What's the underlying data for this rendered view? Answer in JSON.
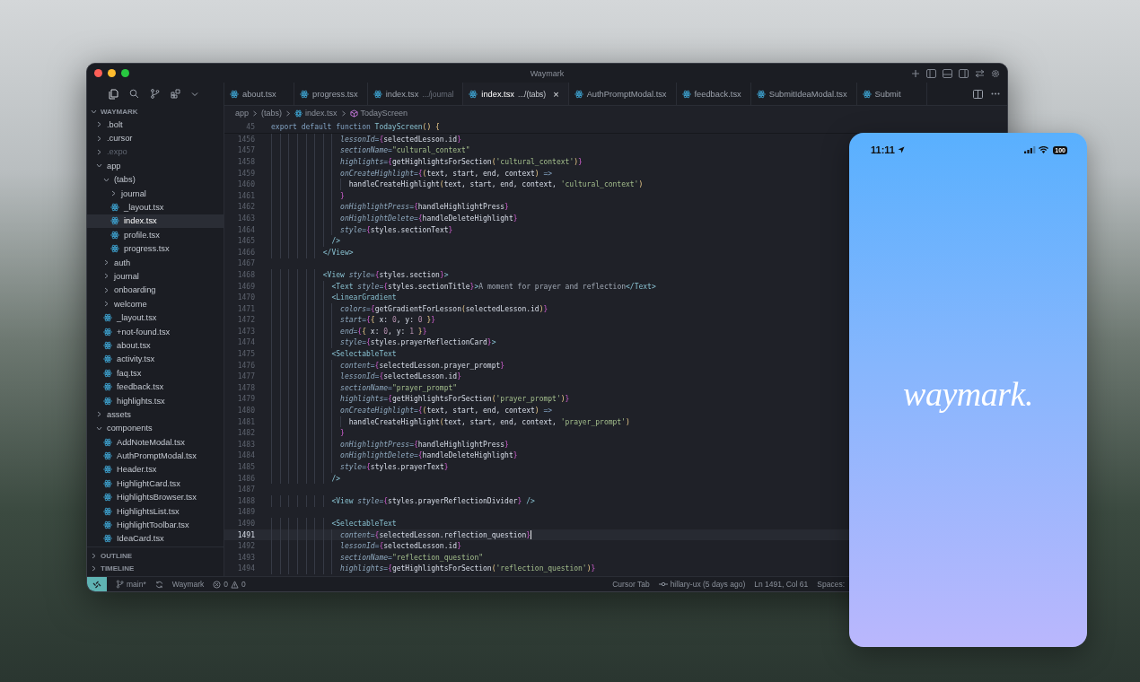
{
  "window": {
    "title": "Waymark"
  },
  "sidebar": {
    "section": {
      "title": "WAYMARK",
      "expanded": true
    },
    "tree": [
      {
        "name": ".bolt",
        "kind": "folder",
        "expanded": false,
        "selected": false,
        "ignored": false
      },
      {
        "name": ".cursor",
        "kind": "folder",
        "expanded": false,
        "selected": false,
        "ignored": false
      },
      {
        "name": ".expo",
        "kind": "folder",
        "expanded": false,
        "selected": false,
        "ignored": true
      },
      {
        "name": "app",
        "kind": "folder",
        "expanded": true,
        "selected": false,
        "ignored": false,
        "children": [
          {
            "name": "(tabs)",
            "kind": "folder",
            "expanded": true,
            "selected": false,
            "ignored": false,
            "children": [
              {
                "name": "journal",
                "kind": "folder",
                "expanded": false,
                "selected": false,
                "ignored": false
              },
              {
                "name": "_layout.tsx",
                "kind": "file",
                "selected": false,
                "ignored": false
              },
              {
                "name": "index.tsx",
                "kind": "file",
                "selected": true,
                "ignored": false
              },
              {
                "name": "profile.tsx",
                "kind": "file",
                "selected": false,
                "ignored": false
              },
              {
                "name": "progress.tsx",
                "kind": "file",
                "selected": false,
                "ignored": false
              }
            ]
          },
          {
            "name": "auth",
            "kind": "folder",
            "expanded": false,
            "selected": false,
            "ignored": false
          },
          {
            "name": "journal",
            "kind": "folder",
            "expanded": false,
            "selected": false,
            "ignored": false
          },
          {
            "name": "onboarding",
            "kind": "folder",
            "expanded": false,
            "selected": false,
            "ignored": false
          },
          {
            "name": "welcome",
            "kind": "folder",
            "expanded": false,
            "selected": false,
            "ignored": false
          },
          {
            "name": "_layout.tsx",
            "kind": "file",
            "selected": false,
            "ignored": false
          },
          {
            "name": "+not-found.tsx",
            "kind": "file",
            "selected": false,
            "ignored": false
          },
          {
            "name": "about.tsx",
            "kind": "file",
            "selected": false,
            "ignored": false
          },
          {
            "name": "activity.tsx",
            "kind": "file",
            "selected": false,
            "ignored": false
          },
          {
            "name": "faq.tsx",
            "kind": "file",
            "selected": false,
            "ignored": false
          },
          {
            "name": "feedback.tsx",
            "kind": "file",
            "selected": false,
            "ignored": false
          },
          {
            "name": "highlights.tsx",
            "kind": "file",
            "selected": false,
            "ignored": false
          }
        ]
      },
      {
        "name": "assets",
        "kind": "folder",
        "expanded": false,
        "selected": false,
        "ignored": false
      },
      {
        "name": "components",
        "kind": "folder",
        "expanded": true,
        "selected": false,
        "ignored": false,
        "children": [
          {
            "name": "AddNoteModal.tsx",
            "kind": "file",
            "selected": false,
            "ignored": false
          },
          {
            "name": "AuthPromptModal.tsx",
            "kind": "file",
            "selected": false,
            "ignored": false
          },
          {
            "name": "Header.tsx",
            "kind": "file",
            "selected": false,
            "ignored": false
          },
          {
            "name": "HighlightCard.tsx",
            "kind": "file",
            "selected": false,
            "ignored": false
          },
          {
            "name": "HighlightsBrowser.tsx",
            "kind": "file",
            "selected": false,
            "ignored": false
          },
          {
            "name": "HighlightsList.tsx",
            "kind": "file",
            "selected": false,
            "ignored": false
          },
          {
            "name": "HighlightToolbar.tsx",
            "kind": "file",
            "selected": false,
            "ignored": false
          },
          {
            "name": "IdeaCard.tsx",
            "kind": "file",
            "selected": false,
            "ignored": false
          }
        ]
      }
    ],
    "panels": [
      {
        "title": "OUTLINE",
        "expanded": false
      },
      {
        "title": "TIMELINE",
        "expanded": false
      }
    ]
  },
  "tabs": [
    {
      "label": "about.tsx",
      "selected": false
    },
    {
      "label": "progress.tsx",
      "selected": false
    },
    {
      "label": "index.tsx",
      "description": ".../journal",
      "selected": false
    },
    {
      "label": "index.tsx",
      "description": ".../(tabs)",
      "selected": true,
      "close": "×"
    },
    {
      "label": "AuthPromptModal.tsx",
      "selected": false
    },
    {
      "label": "feedback.tsx",
      "selected": false
    },
    {
      "label": "SubmitIdeaModal.tsx",
      "selected": false
    },
    {
      "label": "Submit",
      "selected": false
    }
  ],
  "breadcrumb": [
    {
      "label": "app",
      "kind": "folder"
    },
    {
      "label": "(tabs)",
      "kind": "folder"
    },
    {
      "label": "index.tsx",
      "kind": "file"
    },
    {
      "label": "TodayScreen",
      "kind": "symbol"
    }
  ],
  "editor": {
    "sticky": {
      "number": "45",
      "tokens": [
        {
          "kind": "kw",
          "text": "export default function "
        },
        {
          "kind": "fn",
          "text": "TodayScreen"
        },
        {
          "kind": "paren",
          "text": "() {"
        }
      ]
    },
    "lines": [
      {
        "number": "1456",
        "active": false,
        "tokens": [
          {
            "kind": "attr",
            "text": "                lessonId"
          },
          {
            "kind": "punc",
            "text": "="
          },
          {
            "kind": "brace",
            "text": "{"
          },
          {
            "kind": "text",
            "text": "selectedLesson.id"
          },
          {
            "kind": "brace",
            "text": "}"
          }
        ]
      },
      {
        "number": "1457",
        "active": false,
        "tokens": [
          {
            "kind": "attr",
            "text": "                sectionName"
          },
          {
            "kind": "punc",
            "text": "="
          },
          {
            "kind": "str",
            "text": "\"cultural_context\""
          }
        ]
      },
      {
        "number": "1458",
        "active": false,
        "tokens": [
          {
            "kind": "attr",
            "text": "                highlights"
          },
          {
            "kind": "punc",
            "text": "="
          },
          {
            "kind": "brace",
            "text": "{"
          },
          {
            "kind": "text",
            "text": "getHighlightsForSection"
          },
          {
            "kind": "paren",
            "text": "("
          },
          {
            "kind": "str",
            "text": "'cultural_context'"
          },
          {
            "kind": "paren",
            "text": ")"
          },
          {
            "kind": "brace",
            "text": "}"
          }
        ]
      },
      {
        "number": "1459",
        "active": false,
        "tokens": [
          {
            "kind": "attr",
            "text": "                onCreateHighlight"
          },
          {
            "kind": "punc",
            "text": "="
          },
          {
            "kind": "brace",
            "text": "{"
          },
          {
            "kind": "paren",
            "text": "("
          },
          {
            "kind": "text",
            "text": "text, start, end, context"
          },
          {
            "kind": "paren",
            "text": ")"
          },
          {
            "kind": "punc",
            "text": " =>"
          }
        ]
      },
      {
        "number": "1460",
        "active": false,
        "tokens": [
          {
            "kind": "text",
            "text": "                  handleCreateHighlight"
          },
          {
            "kind": "paren",
            "text": "("
          },
          {
            "kind": "text",
            "text": "text, start, end, context, "
          },
          {
            "kind": "str",
            "text": "'cultural_context'"
          },
          {
            "kind": "paren",
            "text": ")"
          }
        ]
      },
      {
        "number": "1461",
        "active": false,
        "tokens": [
          {
            "kind": "brace",
            "text": "                }"
          }
        ]
      },
      {
        "number": "1462",
        "active": false,
        "tokens": [
          {
            "kind": "attr",
            "text": "                onHighlightPress"
          },
          {
            "kind": "punc",
            "text": "="
          },
          {
            "kind": "brace",
            "text": "{"
          },
          {
            "kind": "text",
            "text": "handleHighlightPress"
          },
          {
            "kind": "brace",
            "text": "}"
          }
        ]
      },
      {
        "number": "1463",
        "active": false,
        "tokens": [
          {
            "kind": "attr",
            "text": "                onHighlightDelete"
          },
          {
            "kind": "punc",
            "text": "="
          },
          {
            "kind": "brace",
            "text": "{"
          },
          {
            "kind": "text",
            "text": "handleDeleteHighlight"
          },
          {
            "kind": "brace",
            "text": "}"
          }
        ]
      },
      {
        "number": "1464",
        "active": false,
        "tokens": [
          {
            "kind": "attr",
            "text": "                style"
          },
          {
            "kind": "punc",
            "text": "="
          },
          {
            "kind": "brace",
            "text": "{"
          },
          {
            "kind": "text",
            "text": "styles.sectionText"
          },
          {
            "kind": "brace",
            "text": "}"
          }
        ]
      },
      {
        "number": "1465",
        "active": false,
        "tokens": [
          {
            "kind": "tag",
            "text": "              />"
          }
        ]
      },
      {
        "number": "1466",
        "active": false,
        "tokens": [
          {
            "kind": "tag",
            "text": "            </View>"
          }
        ]
      },
      {
        "number": "1467",
        "active": false
      },
      {
        "number": "1468",
        "active": false,
        "tokens": [
          {
            "kind": "tag",
            "text": "            <View "
          },
          {
            "kind": "attr",
            "text": "style"
          },
          {
            "kind": "punc",
            "text": "="
          },
          {
            "kind": "brace",
            "text": "{"
          },
          {
            "kind": "text",
            "text": "styles.section"
          },
          {
            "kind": "brace",
            "text": "}"
          },
          {
            "kind": "tag",
            "text": ">"
          }
        ]
      },
      {
        "number": "1469",
        "active": false,
        "tokens": [
          {
            "kind": "tag",
            "text": "              <Text "
          },
          {
            "kind": "attr",
            "text": "style"
          },
          {
            "kind": "punc",
            "text": "="
          },
          {
            "kind": "brace",
            "text": "{"
          },
          {
            "kind": "text",
            "text": "styles.sectionTitle"
          },
          {
            "kind": "brace",
            "text": "}"
          },
          {
            "kind": "tag",
            "text": ">"
          },
          {
            "kind": "content",
            "text": "A moment for prayer and reflection"
          },
          {
            "kind": "tag",
            "text": "</Text>"
          }
        ]
      },
      {
        "number": "1470",
        "active": false,
        "tokens": [
          {
            "kind": "tag",
            "text": "              <LinearGradient"
          }
        ]
      },
      {
        "number": "1471",
        "active": false,
        "tokens": [
          {
            "kind": "attr",
            "text": "                colors"
          },
          {
            "kind": "punc",
            "text": "="
          },
          {
            "kind": "brace",
            "text": "{"
          },
          {
            "kind": "text",
            "text": "getGradientForLesson"
          },
          {
            "kind": "paren",
            "text": "("
          },
          {
            "kind": "text",
            "text": "selectedLesson.id"
          },
          {
            "kind": "paren",
            "text": ")"
          },
          {
            "kind": "brace",
            "text": "}"
          }
        ]
      },
      {
        "number": "1472",
        "active": false,
        "tokens": [
          {
            "kind": "attr",
            "text": "                start"
          },
          {
            "kind": "punc",
            "text": "="
          },
          {
            "kind": "brace",
            "text": "{"
          },
          {
            "kind": "paren",
            "text": "{"
          },
          {
            "kind": "text",
            "text": " x: "
          },
          {
            "kind": "num",
            "text": "0"
          },
          {
            "kind": "text",
            "text": ", y: "
          },
          {
            "kind": "num",
            "text": "0"
          },
          {
            "kind": "paren",
            "text": " }"
          },
          {
            "kind": "brace",
            "text": "}"
          }
        ]
      },
      {
        "number": "1473",
        "active": false,
        "tokens": [
          {
            "kind": "attr",
            "text": "                end"
          },
          {
            "kind": "punc",
            "text": "="
          },
          {
            "kind": "brace",
            "text": "{"
          },
          {
            "kind": "paren",
            "text": "{"
          },
          {
            "kind": "text",
            "text": " x: "
          },
          {
            "kind": "num",
            "text": "0"
          },
          {
            "kind": "text",
            "text": ", y: "
          },
          {
            "kind": "num",
            "text": "1"
          },
          {
            "kind": "paren",
            "text": " }"
          },
          {
            "kind": "brace",
            "text": "}"
          }
        ]
      },
      {
        "number": "1474",
        "active": false,
        "tokens": [
          {
            "kind": "attr",
            "text": "                style"
          },
          {
            "kind": "punc",
            "text": "="
          },
          {
            "kind": "brace",
            "text": "{"
          },
          {
            "kind": "text",
            "text": "styles.prayerReflectionCard"
          },
          {
            "kind": "brace",
            "text": "}"
          },
          {
            "kind": "tag",
            "text": ">"
          }
        ]
      },
      {
        "number": "1475",
        "active": false,
        "tokens": [
          {
            "kind": "tag",
            "text": "              <SelectableText"
          }
        ]
      },
      {
        "number": "1476",
        "active": false,
        "tokens": [
          {
            "kind": "attr",
            "text": "                content"
          },
          {
            "kind": "punc",
            "text": "="
          },
          {
            "kind": "brace",
            "text": "{"
          },
          {
            "kind": "text",
            "text": "selectedLesson.prayer_prompt"
          },
          {
            "kind": "brace",
            "text": "}"
          }
        ]
      },
      {
        "number": "1477",
        "active": false,
        "tokens": [
          {
            "kind": "attr",
            "text": "                lessonId"
          },
          {
            "kind": "punc",
            "text": "="
          },
          {
            "kind": "brace",
            "text": "{"
          },
          {
            "kind": "text",
            "text": "selectedLesson.id"
          },
          {
            "kind": "brace",
            "text": "}"
          }
        ]
      },
      {
        "number": "1478",
        "active": false,
        "tokens": [
          {
            "kind": "attr",
            "text": "                sectionName"
          },
          {
            "kind": "punc",
            "text": "="
          },
          {
            "kind": "str",
            "text": "\"prayer_prompt\""
          }
        ]
      },
      {
        "number": "1479",
        "active": false,
        "tokens": [
          {
            "kind": "attr",
            "text": "                highlights"
          },
          {
            "kind": "punc",
            "text": "="
          },
          {
            "kind": "brace",
            "text": "{"
          },
          {
            "kind": "text",
            "text": "getHighlightsForSection"
          },
          {
            "kind": "paren",
            "text": "("
          },
          {
            "kind": "str",
            "text": "'prayer_prompt'"
          },
          {
            "kind": "paren",
            "text": ")"
          },
          {
            "kind": "brace",
            "text": "}"
          }
        ]
      },
      {
        "number": "1480",
        "active": false,
        "tokens": [
          {
            "kind": "attr",
            "text": "                onCreateHighlight"
          },
          {
            "kind": "punc",
            "text": "="
          },
          {
            "kind": "brace",
            "text": "{"
          },
          {
            "kind": "paren",
            "text": "("
          },
          {
            "kind": "text",
            "text": "text, start, end, context"
          },
          {
            "kind": "paren",
            "text": ")"
          },
          {
            "kind": "punc",
            "text": " =>"
          }
        ]
      },
      {
        "number": "1481",
        "active": false,
        "tokens": [
          {
            "kind": "text",
            "text": "                  handleCreateHighlight"
          },
          {
            "kind": "paren",
            "text": "("
          },
          {
            "kind": "text",
            "text": "text, start, end, context, "
          },
          {
            "kind": "str",
            "text": "'prayer_prompt'"
          },
          {
            "kind": "paren",
            "text": ")"
          }
        ]
      },
      {
        "number": "1482",
        "active": false,
        "tokens": [
          {
            "kind": "brace",
            "text": "                }"
          }
        ]
      },
      {
        "number": "1483",
        "active": false,
        "tokens": [
          {
            "kind": "attr",
            "text": "                onHighlightPress"
          },
          {
            "kind": "punc",
            "text": "="
          },
          {
            "kind": "brace",
            "text": "{"
          },
          {
            "kind": "text",
            "text": "handleHighlightPress"
          },
          {
            "kind": "brace",
            "text": "}"
          }
        ]
      },
      {
        "number": "1484",
        "active": false,
        "tokens": [
          {
            "kind": "attr",
            "text": "                onHighlightDelete"
          },
          {
            "kind": "punc",
            "text": "="
          },
          {
            "kind": "brace",
            "text": "{"
          },
          {
            "kind": "text",
            "text": "handleDeleteHighlight"
          },
          {
            "kind": "brace",
            "text": "}"
          }
        ]
      },
      {
        "number": "1485",
        "active": false,
        "tokens": [
          {
            "kind": "attr",
            "text": "                style"
          },
          {
            "kind": "punc",
            "text": "="
          },
          {
            "kind": "brace",
            "text": "{"
          },
          {
            "kind": "text",
            "text": "styles.prayerText"
          },
          {
            "kind": "brace",
            "text": "}"
          }
        ]
      },
      {
        "number": "1486",
        "active": false,
        "tokens": [
          {
            "kind": "tag",
            "text": "              />"
          }
        ]
      },
      {
        "number": "1487",
        "active": false
      },
      {
        "number": "1488",
        "active": false,
        "tokens": [
          {
            "kind": "tag",
            "text": "              <View "
          },
          {
            "kind": "attr",
            "text": "style"
          },
          {
            "kind": "punc",
            "text": "="
          },
          {
            "kind": "brace",
            "text": "{"
          },
          {
            "kind": "text",
            "text": "styles.prayerReflectionDivider"
          },
          {
            "kind": "brace",
            "text": "}"
          },
          {
            "kind": "tag",
            "text": " />"
          }
        ]
      },
      {
        "number": "1489",
        "active": false
      },
      {
        "number": "1490",
        "active": false,
        "tokens": [
          {
            "kind": "tag",
            "text": "              <SelectableText"
          }
        ]
      },
      {
        "number": "1491",
        "active": true,
        "tokens": [
          {
            "kind": "attr",
            "text": "                content"
          },
          {
            "kind": "punc",
            "text": "="
          },
          {
            "kind": "brace",
            "text": "{"
          },
          {
            "kind": "text",
            "text": "selectedLesson.reflection_question"
          },
          {
            "kind": "brace",
            "text": "}"
          }
        ]
      },
      {
        "number": "1492",
        "active": false,
        "tokens": [
          {
            "kind": "attr",
            "text": "                lessonId"
          },
          {
            "kind": "punc",
            "text": "="
          },
          {
            "kind": "brace",
            "text": "{"
          },
          {
            "kind": "text",
            "text": "selectedLesson.id"
          },
          {
            "kind": "brace",
            "text": "}"
          }
        ]
      },
      {
        "number": "1493",
        "active": false,
        "tokens": [
          {
            "kind": "attr",
            "text": "                sectionName"
          },
          {
            "kind": "punc",
            "text": "="
          },
          {
            "kind": "str",
            "text": "\"reflection_question\""
          }
        ]
      },
      {
        "number": "1494",
        "active": false,
        "tokens": [
          {
            "kind": "attr",
            "text": "                highlights"
          },
          {
            "kind": "punc",
            "text": "="
          },
          {
            "kind": "brace",
            "text": "{"
          },
          {
            "kind": "text",
            "text": "getHighlightsForSection"
          },
          {
            "kind": "paren",
            "text": "("
          },
          {
            "kind": "str",
            "text": "'reflection_question'"
          },
          {
            "kind": "paren",
            "text": ")"
          },
          {
            "kind": "brace",
            "text": "}"
          }
        ]
      }
    ]
  },
  "status_bar": {
    "branch": "main*",
    "project": "Waymark",
    "errors": "0",
    "warnings": "0",
    "cursor_tab": "Cursor Tab",
    "blame": "hillary-ux (5 days ago)",
    "position": "Ln 1491, Col 61",
    "spaces": "Spaces:"
  },
  "phone": {
    "time": "11:11",
    "battery": "100",
    "logo": "waymark."
  }
}
